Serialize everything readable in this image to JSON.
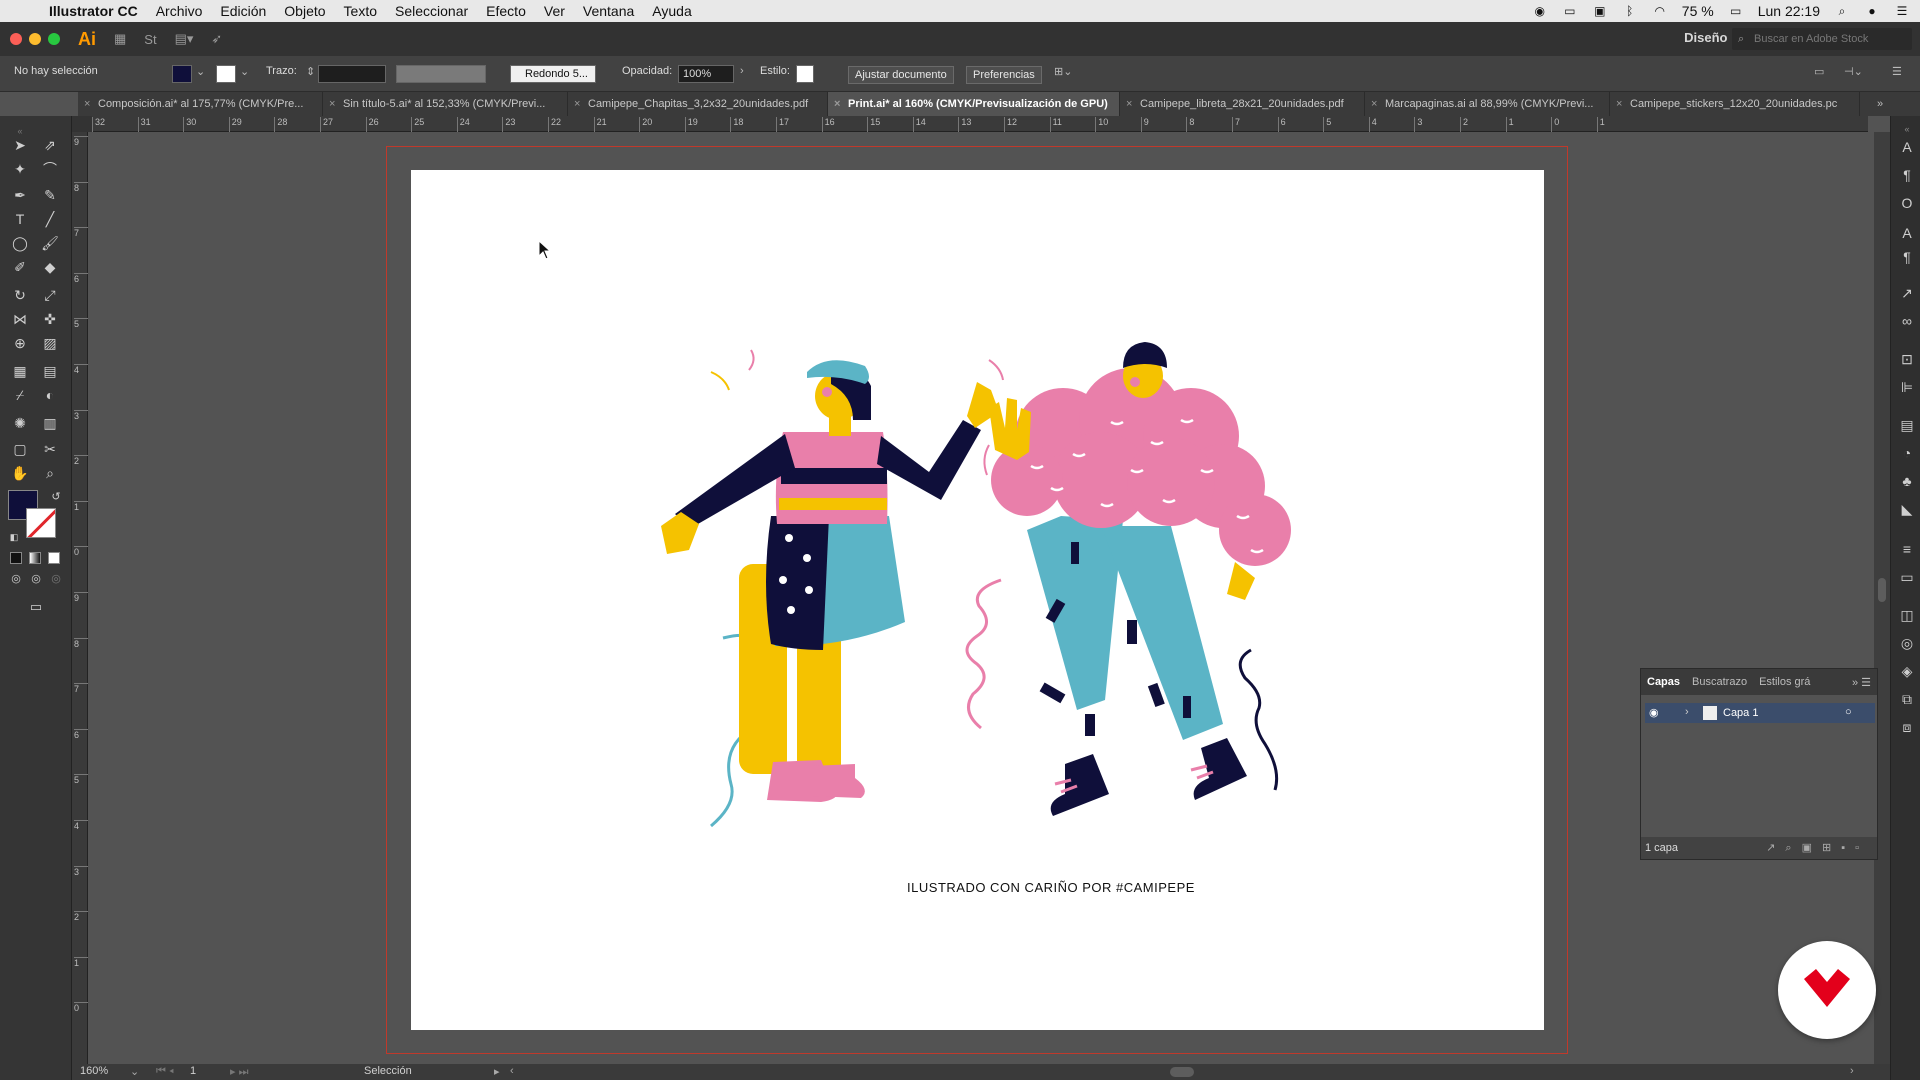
{
  "menubar": {
    "app": "Illustrator CC",
    "items": [
      "Archivo",
      "Edición",
      "Objeto",
      "Texto",
      "Seleccionar",
      "Efecto",
      "Ver",
      "Ventana",
      "Ayuda"
    ],
    "battery": "75 %",
    "clock": "Lun 22:19"
  },
  "appbar": {
    "logo": "Ai",
    "workspace": "Diseño",
    "search_placeholder": "Buscar en Adobe Stock"
  },
  "control": {
    "selection": "No hay selección",
    "stroke_label": "Trazo:",
    "brush": "Redondo 5...",
    "opacity_label": "Opacidad:",
    "opacity": "100%",
    "style_label": "Estilo:",
    "adjust_doc": "Ajustar documento",
    "prefs": "Preferencias",
    "fill_color": "#0f0f3a"
  },
  "tabs": [
    {
      "label": "Composición.ai* al 175,77% (CMYK/Pre..."
    },
    {
      "label": "Sin título-5.ai* al 152,33% (CMYK/Previ..."
    },
    {
      "label": "Camipepe_Chapitas_3,2x32_20unidades.pdf"
    },
    {
      "label": "Print.ai* al 160% (CMYK/Previsualización de GPU)",
      "active": true
    },
    {
      "label": "Camipepe_libreta_28x21_20unidades.pdf"
    },
    {
      "label": "Marcapaginas.ai al 88,99% (CMYK/Previ..."
    },
    {
      "label": "Camipepe_stickers_12x20_20unidades.pc"
    }
  ],
  "ruler_h": [
    "32",
    "31",
    "30",
    "29",
    "28",
    "27",
    "26",
    "25",
    "24",
    "23",
    "22",
    "21",
    "20",
    "19",
    "18",
    "17",
    "16",
    "15",
    "14",
    "13",
    "12",
    "11",
    "10",
    "9",
    "8",
    "7",
    "6",
    "5",
    "4",
    "3",
    "2",
    "1",
    "0",
    "1"
  ],
  "ruler_v": [
    "9",
    "8",
    "7",
    "6",
    "5",
    "4",
    "3",
    "2",
    "1",
    "0",
    "9",
    "8",
    "7",
    "6",
    "5",
    "4",
    "3",
    "2",
    "1",
    "0"
  ],
  "artwork": {
    "caption": "ILUSTRADO CON CARIÑO POR #CAMIPEPE",
    "colors": {
      "navy": "#0f0f3a",
      "pink": "#e97faa",
      "yellow": "#f5c200",
      "teal": "#5bb4c6",
      "skin": "#f4b400"
    }
  },
  "layers_panel": {
    "tabs": [
      "Capas",
      "Buscatrazo",
      "Estilos grá"
    ],
    "layer_name": "Capa 1",
    "footer": "1 capa"
  },
  "status": {
    "zoom": "160%",
    "page": "1",
    "tool": "Selección"
  }
}
